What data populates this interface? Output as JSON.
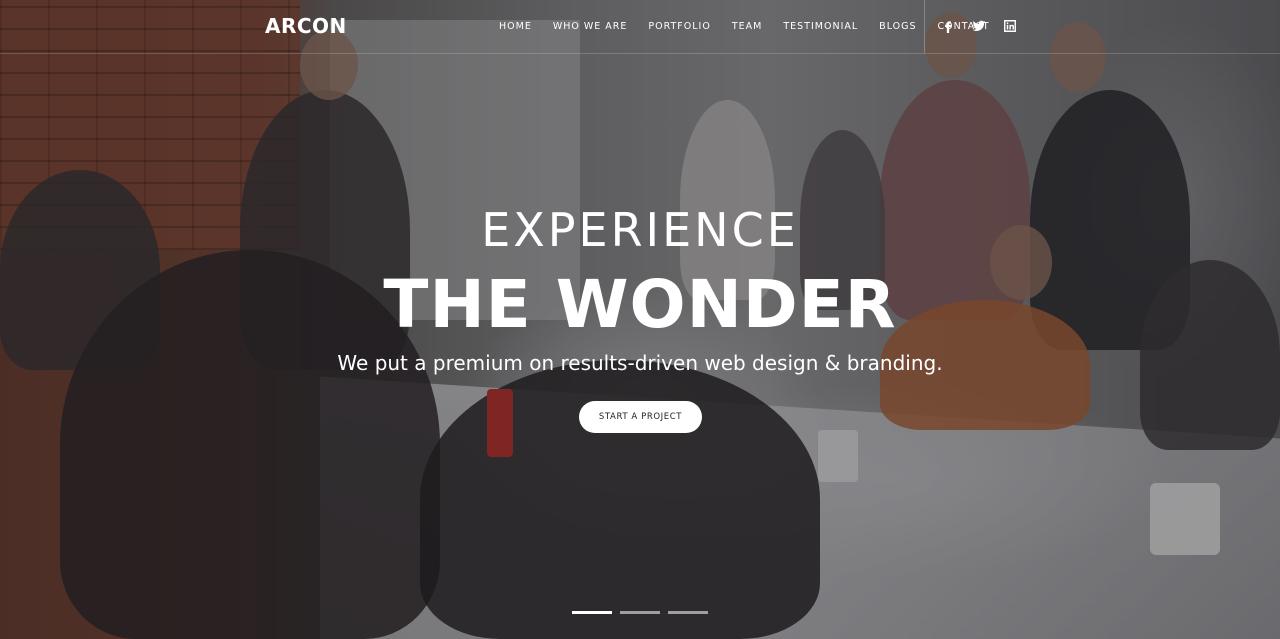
{
  "brand": {
    "logo_text": "ARCON"
  },
  "nav": {
    "items": [
      {
        "label": "HOME"
      },
      {
        "label": "WHO WE ARE"
      },
      {
        "label": "PORTFOLIO"
      },
      {
        "label": "TEAM"
      },
      {
        "label": "TESTIMONIAL"
      },
      {
        "label": "BLOGS"
      },
      {
        "label": "CONTACT"
      }
    ],
    "social": [
      {
        "icon": "facebook-icon"
      },
      {
        "icon": "twitter-icon"
      },
      {
        "icon": "linkedin-icon"
      }
    ]
  },
  "hero": {
    "eyebrow": "EXPERIENCE",
    "headline": "THE WONDER",
    "subline": "We put a premium on results-driven web design & branding.",
    "cta_label": "START A PROJECT"
  },
  "slider": {
    "slide_count": 3,
    "active_index": 0
  },
  "colors": {
    "text": "#ffffff",
    "cta_background": "#ffffff",
    "cta_text": "#222222"
  }
}
